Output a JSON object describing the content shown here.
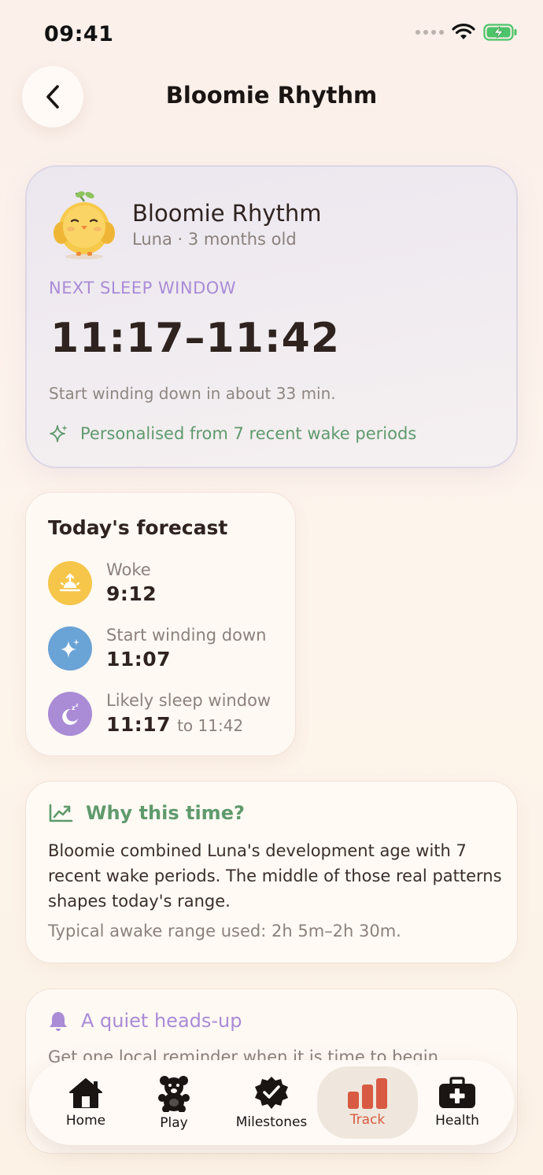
{
  "status": {
    "time": "09:41"
  },
  "header": {
    "title": "Bloomie Rhythm"
  },
  "hero": {
    "title": "Bloomie Rhythm",
    "subtitle": "Luna · 3 months old",
    "label": "NEXT SLEEP WINDOW",
    "time_range": "11:17–11:42",
    "note": "Start winding down in about 33 min.",
    "personalised": "Personalised from 7 recent wake periods"
  },
  "forecast": {
    "title": "Today's forecast",
    "items": [
      {
        "label": "Woke",
        "value": "9:12",
        "icon": "sunrise-icon",
        "color": "#f6c64a"
      },
      {
        "label": "Start winding down",
        "value": "11:07",
        "icon": "sparkle-icon",
        "color": "#6aa3d6"
      },
      {
        "label": "Likely sleep window",
        "value": "11:17",
        "suffix": "to 11:42",
        "icon": "moon-icon",
        "color": "#a98bd6"
      }
    ]
  },
  "why": {
    "title": "Why this time?",
    "body": "Bloomie combined Luna's development age with 7 recent wake periods. The middle of those real patterns shapes today's range.",
    "range": "Typical awake range used: 2h 5m–2h 30m."
  },
  "heads_up": {
    "title": "A quiet heads-up",
    "body": "Get one local reminder when it is time to begin"
  },
  "tabs": [
    {
      "label": "Home",
      "icon": "home-icon"
    },
    {
      "label": "Play",
      "icon": "teddy-bear-icon"
    },
    {
      "label": "Milestones",
      "icon": "badge-check-icon"
    },
    {
      "label": "Track",
      "icon": "bar-chart-icon",
      "active": true
    },
    {
      "label": "Health",
      "icon": "medical-kit-icon"
    }
  ],
  "colors": {
    "accent_red": "#d85a43",
    "accent_purple": "#a98bd6",
    "accent_green": "#5f9a6d"
  }
}
